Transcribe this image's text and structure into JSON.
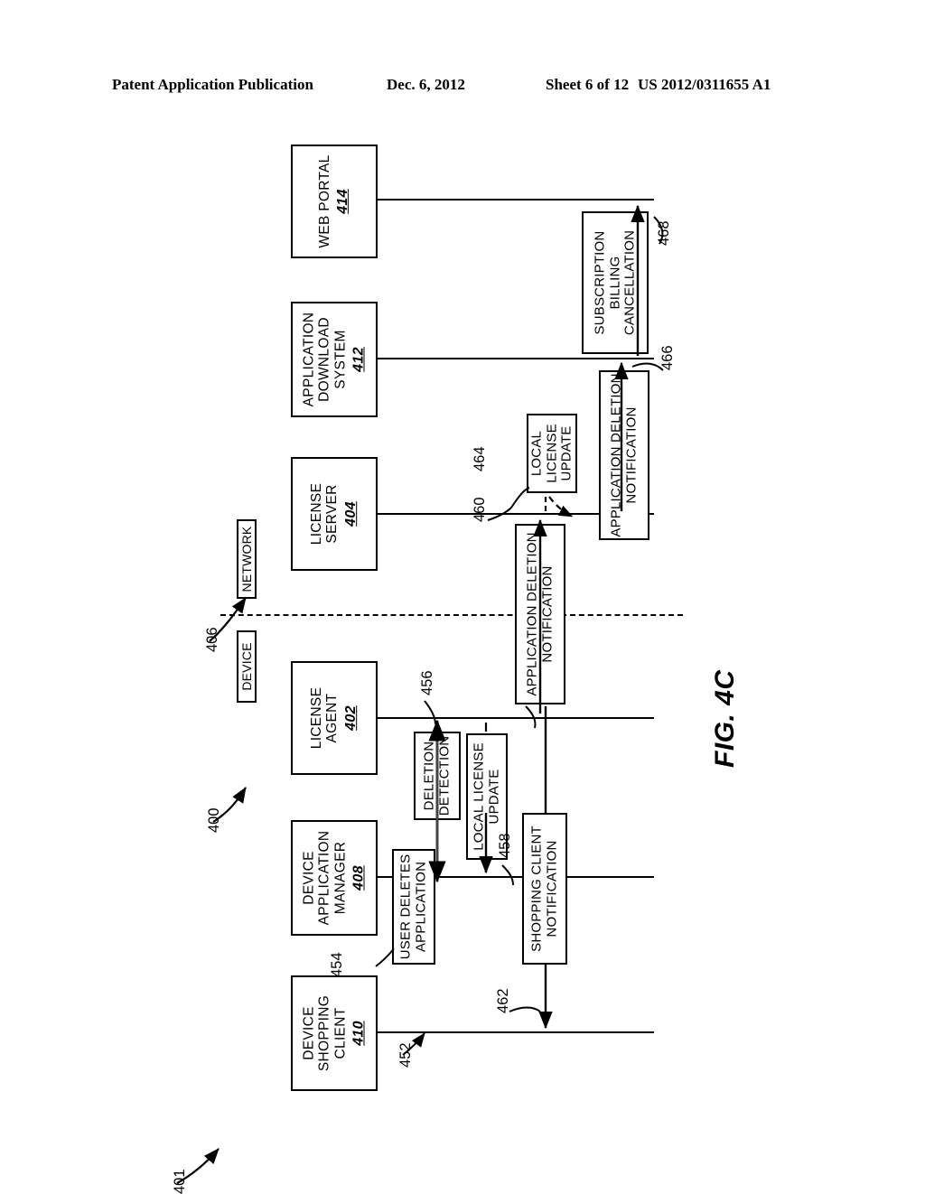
{
  "header": {
    "publication": "Patent Application Publication",
    "date": "Dec. 6, 2012",
    "sheet": "Sheet 6 of 12",
    "patent_number": "US 2012/0311655 A1"
  },
  "figure": {
    "caption": "FIG. 4C",
    "diagram_ref": "400",
    "system_ref": "401",
    "network_ref": "406"
  },
  "domains": {
    "network_label": "NETWORK",
    "device_label": "DEVICE"
  },
  "actors": [
    {
      "name": "web-portal",
      "label": "WEB PORTAL",
      "ref": "414"
    },
    {
      "name": "application-download-system",
      "label": "APPLICATION\nDOWNLOAD\nSYSTEM",
      "ref": "412"
    },
    {
      "name": "license-server",
      "label": "LICENSE\nSERVER",
      "ref": "404"
    },
    {
      "name": "license-agent",
      "label": "LICENSE\nAGENT",
      "ref": "402"
    },
    {
      "name": "device-application-manager",
      "label": "DEVICE\nAPPLICATION\nMANAGER",
      "ref": "408"
    },
    {
      "name": "device-shopping-client",
      "label": "DEVICE\nSHOPPING\nCLIENT",
      "ref": "410"
    }
  ],
  "messages": [
    {
      "name": "subscription-billing-cancellation",
      "label": "SUBSCRIPTION\nBILLING\nCANCELLATION",
      "ref": "468"
    },
    {
      "name": "application-deletion-notification-network",
      "label": "APPLICATION DELETION\nNOTIFICATION",
      "ref": "466"
    },
    {
      "name": "local-license-update-network",
      "label": "LOCAL\nLICENSE\nUPDATE",
      "ref": "464"
    },
    {
      "name": "application-deletion-notification-device",
      "label": "APPLICATION DELETION\nNOTIFICATION",
      "ref": "460"
    },
    {
      "name": "deletion-detection",
      "label": "DELETION\nDETECTION",
      "ref": "456"
    },
    {
      "name": "local-license-update-device",
      "label": "LOCAL LICENSE\nUPDATE",
      "ref": "458"
    },
    {
      "name": "user-deletes-application",
      "label": "USER DELETES\nAPPLICATION",
      "ref": "454"
    },
    {
      "name": "shopping-client-notification",
      "label": "SHOPPING CLIENT\nNOTIFICATION",
      "ref": "462"
    }
  ],
  "ref_labels": {
    "r400": "400",
    "r401": "401",
    "r406": "406",
    "r452": "452",
    "r454": "454",
    "r456": "456",
    "r458": "458",
    "r460": "460",
    "r462": "462",
    "r464": "464",
    "r466": "466",
    "r468": "468"
  }
}
